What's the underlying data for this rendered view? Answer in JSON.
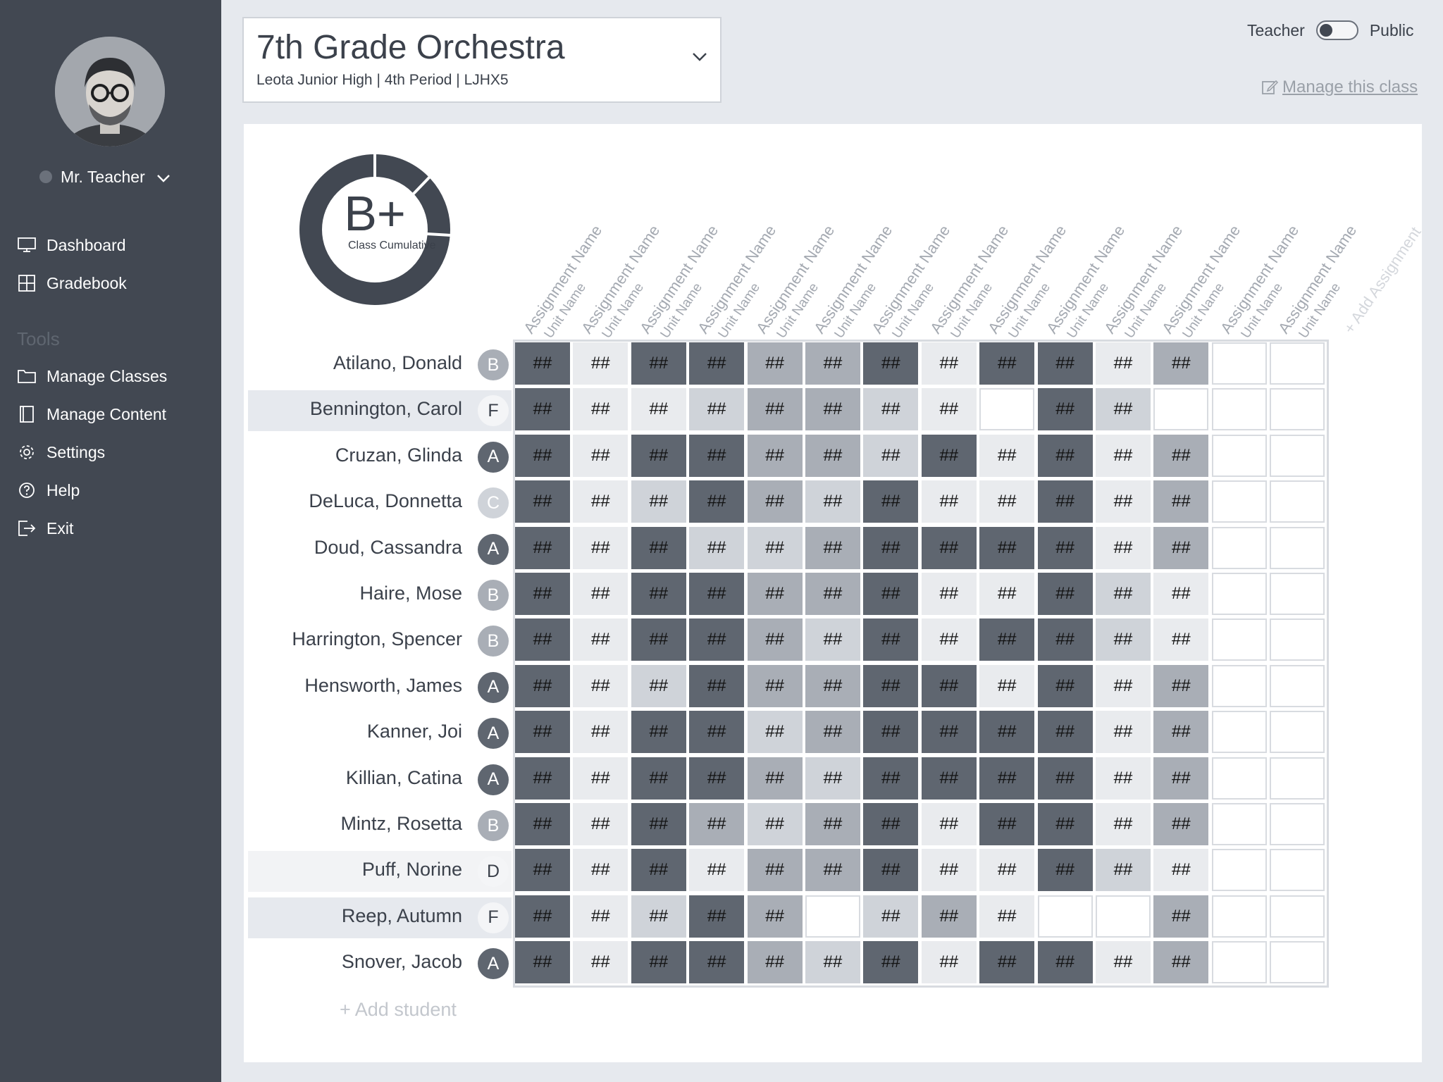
{
  "colors": {
    "sidebar_bg": "#424852",
    "page_bg": "#e6e9ee",
    "shade_dark": "#5f6670",
    "shade_mid": "#a9aeb6",
    "shade_light": "#cfd3d9",
    "shade_lighter": "#e9ebee",
    "text": "#3b414b",
    "muted": "#9aa0a8"
  },
  "sidebar": {
    "user_name": "Mr. Teacher",
    "nav": [
      {
        "label": "Dashboard",
        "icon": "monitor-icon"
      },
      {
        "label": "Gradebook",
        "icon": "grid-icon"
      }
    ],
    "tools_heading": "Tools",
    "tools": [
      {
        "label": "Manage Classes",
        "icon": "folder-icon"
      },
      {
        "label": "Manage Content",
        "icon": "book-icon"
      },
      {
        "label": "Settings",
        "icon": "gear-icon"
      },
      {
        "label": "Help",
        "icon": "help-icon"
      },
      {
        "label": "Exit",
        "icon": "exit-icon"
      }
    ]
  },
  "header": {
    "class_title": "7th Grade Orchestra",
    "class_subtitle": "Leota Junior High | 4th Period | LJHX5",
    "toggle_left": "Teacher",
    "toggle_right": "Public",
    "toggle_state": "Teacher",
    "manage_link": "Manage this class"
  },
  "summary": {
    "grade": "B+",
    "label": "Class Cumulative"
  },
  "assignments": [
    {
      "name": "Assignment Name",
      "unit": "Unit Name"
    },
    {
      "name": "Assignment Name",
      "unit": "Unit Name"
    },
    {
      "name": "Assignment Name",
      "unit": "Unit Name"
    },
    {
      "name": "Assignment Name",
      "unit": "Unit Name"
    },
    {
      "name": "Assignment Name",
      "unit": "Unit Name"
    },
    {
      "name": "Assignment Name",
      "unit": "Unit Name"
    },
    {
      "name": "Assignment Name",
      "unit": "Unit Name"
    },
    {
      "name": "Assignment Name",
      "unit": "Unit Name"
    },
    {
      "name": "Assignment Name",
      "unit": "Unit Name"
    },
    {
      "name": "Assignment Name",
      "unit": "Unit Name"
    },
    {
      "name": "Assignment Name",
      "unit": "Unit Name"
    },
    {
      "name": "Assignment Name",
      "unit": "Unit Name"
    },
    {
      "name": "Assignment Name",
      "unit": "Unit Name"
    },
    {
      "name": "Assignment Name",
      "unit": "Unit Name"
    }
  ],
  "add_assignment": "+ Add Assignment",
  "add_student": "+ Add student",
  "cell_text": "##",
  "shade_legend": "0=empty, 1=lighter, 2=light, 3=mid, 4=dark",
  "students": [
    {
      "name": "Atilano, Donald",
      "grade": "B",
      "highlight": "none",
      "shades": [
        4,
        1,
        4,
        4,
        3,
        3,
        4,
        1,
        4,
        4,
        1,
        3,
        0,
        0
      ]
    },
    {
      "name": "Bennington, Carol",
      "grade": "F",
      "highlight": "mid",
      "shades": [
        4,
        1,
        1,
        2,
        3,
        3,
        2,
        1,
        0,
        4,
        2,
        0,
        0,
        0
      ]
    },
    {
      "name": "Cruzan, Glinda",
      "grade": "A",
      "highlight": "none",
      "shades": [
        4,
        1,
        4,
        4,
        3,
        3,
        2,
        4,
        1,
        4,
        1,
        3,
        0,
        0
      ]
    },
    {
      "name": "DeLuca, Donnetta",
      "grade": "C",
      "highlight": "none",
      "shades": [
        4,
        1,
        2,
        4,
        3,
        2,
        4,
        1,
        1,
        4,
        1,
        3,
        0,
        0
      ]
    },
    {
      "name": "Doud, Cassandra",
      "grade": "A",
      "highlight": "none",
      "shades": [
        4,
        1,
        4,
        2,
        2,
        3,
        4,
        4,
        4,
        4,
        1,
        3,
        0,
        0
      ]
    },
    {
      "name": "Haire, Mose",
      "grade": "B",
      "highlight": "none",
      "shades": [
        4,
        1,
        4,
        4,
        3,
        3,
        4,
        1,
        1,
        4,
        2,
        1,
        0,
        0
      ]
    },
    {
      "name": "Harrington, Spencer",
      "grade": "B",
      "highlight": "none",
      "shades": [
        4,
        1,
        4,
        4,
        3,
        2,
        4,
        1,
        4,
        4,
        2,
        1,
        0,
        0
      ]
    },
    {
      "name": "Hensworth, James",
      "grade": "A",
      "highlight": "none",
      "shades": [
        4,
        1,
        2,
        4,
        3,
        3,
        4,
        4,
        1,
        4,
        1,
        3,
        0,
        0
      ]
    },
    {
      "name": "Kanner, Joi",
      "grade": "A",
      "highlight": "none",
      "shades": [
        4,
        1,
        4,
        4,
        2,
        3,
        4,
        4,
        4,
        4,
        1,
        3,
        0,
        0
      ]
    },
    {
      "name": "Killian, Catina",
      "grade": "A",
      "highlight": "none",
      "shades": [
        4,
        1,
        4,
        4,
        3,
        2,
        4,
        4,
        4,
        4,
        1,
        3,
        0,
        0
      ]
    },
    {
      "name": "Mintz, Rosetta",
      "grade": "B",
      "highlight": "none",
      "shades": [
        4,
        1,
        4,
        3,
        2,
        3,
        4,
        1,
        4,
        4,
        1,
        3,
        0,
        0
      ]
    },
    {
      "name": "Puff, Norine",
      "grade": "D",
      "highlight": "light",
      "shades": [
        4,
        1,
        4,
        1,
        3,
        3,
        4,
        1,
        1,
        4,
        2,
        1,
        0,
        0
      ]
    },
    {
      "name": "Reep, Autumn",
      "grade": "F",
      "highlight": "mid",
      "shades": [
        4,
        1,
        2,
        4,
        3,
        0,
        2,
        3,
        1,
        0,
        0,
        3,
        0,
        0
      ]
    },
    {
      "name": "Snover, Jacob",
      "grade": "A",
      "highlight": "none",
      "shades": [
        4,
        1,
        4,
        4,
        3,
        2,
        4,
        1,
        4,
        4,
        1,
        3,
        0,
        0
      ]
    }
  ]
}
